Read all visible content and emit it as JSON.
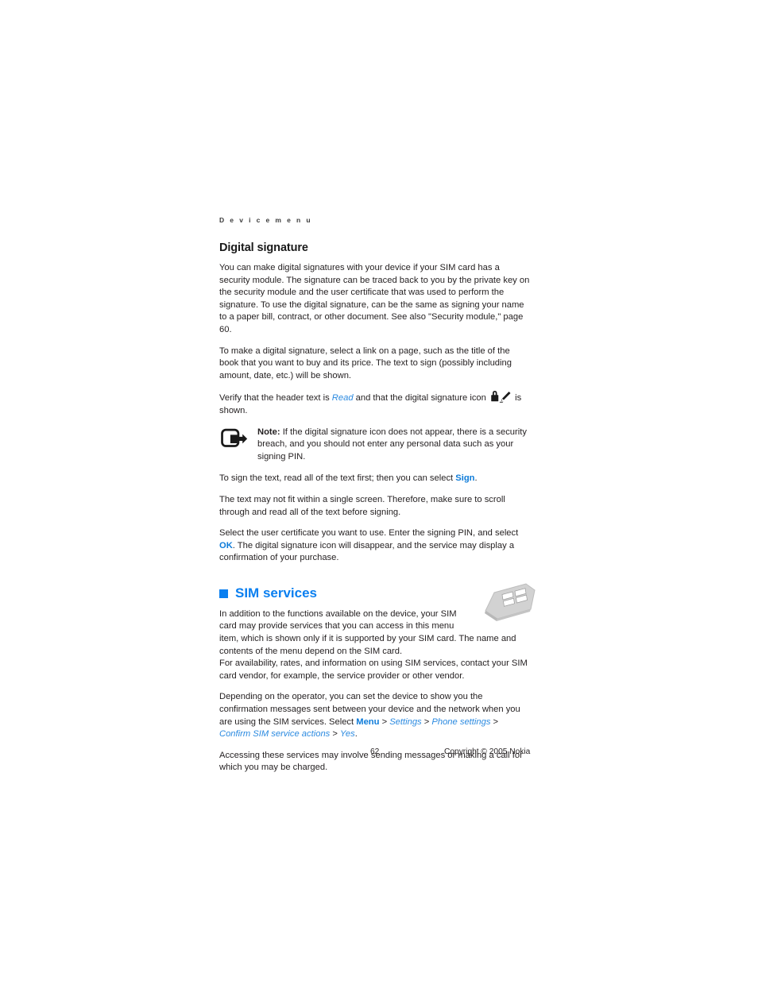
{
  "document": {
    "running_header": "D e v i c e   m e n u",
    "page_number": "62",
    "copyright": "Copyright © 2005 Nokia"
  },
  "section": {
    "title": "Digital signature",
    "paragraphs": {
      "p1": "You can make digital signatures with your device if your SIM card has a security module. The signature can be traced back to you by the private key on the security module and the user certificate that was used to perform the signature. To use the digital signature, can be the same as signing your name to a paper bill, contract, or other document. See also \"Security module,\" page 60.",
      "p2": "To make a digital signature, select a link on a page, such as the title of the book that you want to buy and its price. The text to sign (possibly including amount, date, etc.) will be shown.",
      "p3_part1": "Verify that the header text is ",
      "p3_link": "Read",
      "p3_part2": " and that the digital signature icon ",
      "p3_part3": " is shown.",
      "p5_part1": "To sign the text, read all of the text first; then you can select ",
      "p5_link": "Sign",
      "p5_part2": ".",
      "p6": "The text may not fit within a single screen. Therefore, make sure to scroll through and read all of the text before signing.",
      "p7_part1": "Select the user certificate you want to use. Enter the signing PIN, and select ",
      "p7_link": "OK",
      "p7_part2": ". The digital signature icon will disappear, and the service may display a confirmation of your purchase."
    },
    "note": {
      "label": "Note:",
      "text": " If the digital signature icon does not appear, there is a security breach, and you should not enter any personal data such as your signing PIN."
    }
  },
  "chapter": {
    "title": "SIM services",
    "paragraphs": {
      "p1": "In addition to the functions available on the device, your SIM card may provide services that you can access in this menu item, which is shown only if it is supported by your SIM card. The name and contents of the menu depend on the SIM card.",
      "p2": "For availability, rates, and information on using SIM services, contact your SIM card vendor, for example, the service provider or other vendor.",
      "p3_part1": "Depending on the operator, you can set the device to show you the confirmation messages sent between your device and the network when you are using the SIM services. Select ",
      "p3_menu": "Menu",
      "p3_sep1": " > ",
      "p3_settings": "Settings",
      "p3_sep2": " > ",
      "p3_phone_settings": "Phone settings",
      "p3_sep3": " > ",
      "p3_confirm": "Confirm SIM service actions",
      "p3_sep4": " > ",
      "p3_yes": "Yes",
      "p3_end": ".",
      "p4": "Accessing these services may involve sending messages or making a call for which you may be charged."
    }
  },
  "icons": {
    "note_icon": "note-arrow-icon",
    "digital_signature_icon": "padlock-signature-icon",
    "sim_card_icon": "sim-card-icon",
    "chapter_bullet": "square-bullet-icon"
  },
  "colors": {
    "link_blue": "#0d7bd9",
    "chapter_blue": "#0a7ff0",
    "body_text": "#231f20",
    "header_grey": "#3b3b3b"
  }
}
